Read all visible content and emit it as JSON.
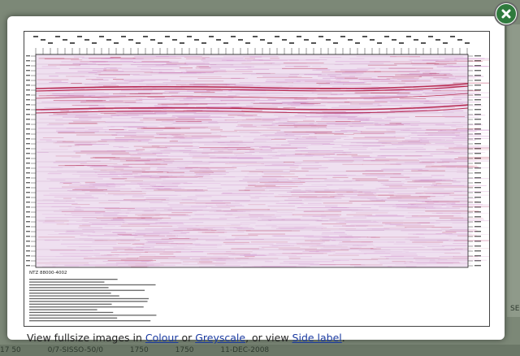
{
  "caption": {
    "prefix": "View fullsize images in ",
    "colour_link": "Colour",
    "or_text": " or ",
    "greyscale_link": "Greyscale",
    "view_text": ", or view ",
    "side_label_link": "Side label",
    "suffix": "."
  },
  "background": {
    "bottom_items": [
      "17 50",
      "0/7-SISSO-50/0",
      "1750",
      "1750",
      "11-DEC-2008"
    ],
    "side_text": "SEC"
  },
  "figure": {
    "line_label": "NTZ 88000-4002"
  },
  "colors": {
    "close_green": "#2f7a3d",
    "link_blue": "#1a3aa0",
    "seismic_red": "#b0103a",
    "seismic_magenta": "#c878c0"
  }
}
